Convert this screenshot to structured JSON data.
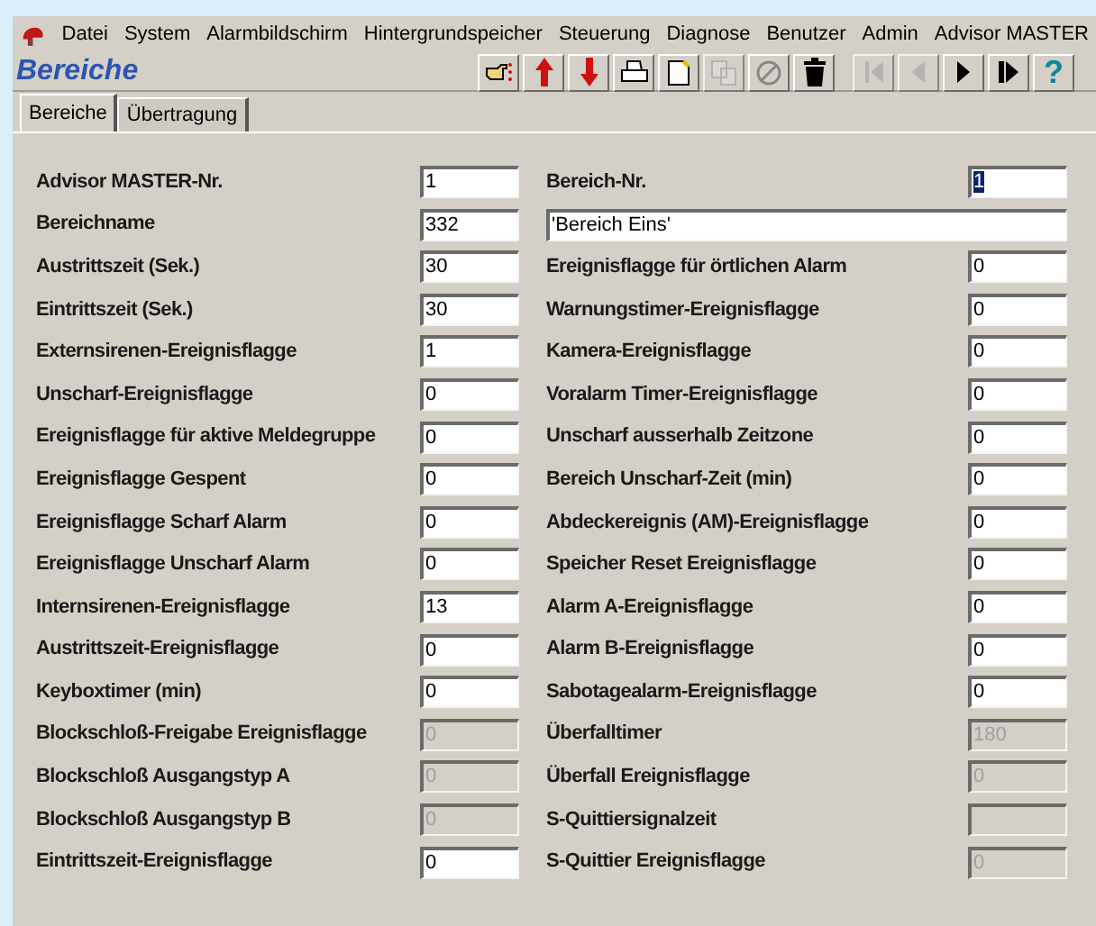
{
  "menu_bar": [
    "Datei",
    "System",
    "Alarmbildschirm",
    "Hintergrundspeicher",
    "Steuerung",
    "Diagnose",
    "Benutzer",
    "Admin",
    "Advisor MASTER"
  ],
  "window": {
    "title": "Bereiche"
  },
  "toolbar": [
    {
      "kind": "hand",
      "disabled": false
    },
    {
      "kind": "up",
      "disabled": false
    },
    {
      "kind": "down",
      "disabled": false
    },
    {
      "kind": "print",
      "disabled": false
    },
    {
      "kind": "new",
      "disabled": false
    },
    {
      "kind": "copy",
      "disabled": true
    },
    {
      "kind": "cancel",
      "disabled": false
    },
    {
      "kind": "trash",
      "disabled": false
    },
    {
      "kind": "first",
      "disabled": true
    },
    {
      "kind": "prev",
      "disabled": true
    },
    {
      "kind": "next",
      "disabled": false
    },
    {
      "kind": "last",
      "disabled": false
    },
    {
      "kind": "help",
      "label": "?",
      "disabled": false
    }
  ],
  "tabs": [
    {
      "label": "Bereiche",
      "selected": true
    },
    {
      "label": "Übertragung",
      "selected": false
    }
  ],
  "left_fields": [
    {
      "label": "Advisor MASTER-Nr.",
      "value": "1",
      "disabled": false
    },
    {
      "label": "Bereichname",
      "value": "332",
      "disabled": false
    },
    {
      "label": "Austrittszeit (Sek.)",
      "value": "30",
      "disabled": false
    },
    {
      "label": "Eintrittszeit (Sek.)",
      "value": "30",
      "disabled": false
    },
    {
      "label": "Externsirenen-Ereignisflagge",
      "value": "1",
      "disabled": false
    },
    {
      "label": "Unscharf-Ereignisflagge",
      "value": "0",
      "disabled": false
    },
    {
      "label": "Ereignisflagge für aktive Meldegruppe",
      "value": "0",
      "disabled": false
    },
    {
      "label": "Ereignisflagge Gespent",
      "value": "0",
      "disabled": false
    },
    {
      "label": "Ereignisflagge Scharf Alarm",
      "value": "0",
      "disabled": false
    },
    {
      "label": "Ereignisflagge Unscharf Alarm",
      "value": "0",
      "disabled": false
    },
    {
      "label": "Internsirenen-Ereignisflagge",
      "value": "13",
      "disabled": false
    },
    {
      "label": "Austrittszeit-Ereignisflagge",
      "value": "0",
      "disabled": false
    },
    {
      "label": "Keyboxtimer (min)",
      "value": "0",
      "disabled": false
    },
    {
      "label": "Blockschloß-Freigabe Ereignisflagge",
      "value": "0",
      "disabled": true
    },
    {
      "label": "Blockschloß Ausgangstyp A",
      "value": "0",
      "disabled": true
    },
    {
      "label": "Blockschloß Ausgangstyp B",
      "value": "0",
      "disabled": true
    },
    {
      "label": "Eintrittszeit-Ereignisflagge",
      "value": "0",
      "disabled": false
    }
  ],
  "right_fields": [
    {
      "kind": "labeled",
      "label": "Bereich-Nr.",
      "value": "1",
      "disabled": false,
      "focused": true
    },
    {
      "kind": "wide",
      "value": "'Bereich Eins'",
      "disabled": false,
      "focused": false
    },
    {
      "kind": "labeled",
      "label": "Ereignisflagge für örtlichen Alarm",
      "value": "0",
      "disabled": false,
      "focused": false
    },
    {
      "kind": "labeled",
      "label": "Warnungstimer-Ereignisflagge",
      "value": "0",
      "disabled": false,
      "focused": false
    },
    {
      "kind": "labeled",
      "label": "Kamera-Ereignisflagge",
      "value": "0",
      "disabled": false,
      "focused": false
    },
    {
      "kind": "labeled",
      "label": "Voralarm Timer-Ereignisflagge",
      "value": "0",
      "disabled": false,
      "focused": false
    },
    {
      "kind": "labeled",
      "label": "Unscharf ausserhalb Zeitzone",
      "value": "0",
      "disabled": false,
      "focused": false
    },
    {
      "kind": "labeled",
      "label": "Bereich Unscharf-Zeit (min)",
      "value": "0",
      "disabled": false,
      "focused": false
    },
    {
      "kind": "labeled",
      "label": "Abdeckereignis (AM)-Ereignisflagge",
      "value": "0",
      "disabled": false,
      "focused": false
    },
    {
      "kind": "labeled",
      "label": "Speicher Reset Ereignisflagge",
      "value": "0",
      "disabled": false,
      "focused": false
    },
    {
      "kind": "labeled",
      "label": "Alarm A-Ereignisflagge",
      "value": "0",
      "disabled": false,
      "focused": false
    },
    {
      "kind": "labeled",
      "label": "Alarm B-Ereignisflagge",
      "value": "0",
      "disabled": false,
      "focused": false
    },
    {
      "kind": "labeled",
      "label": "Sabotagealarm-Ereignisflagge",
      "value": "0",
      "disabled": false,
      "focused": false
    },
    {
      "kind": "labeled",
      "label": "Überfalltimer",
      "value": "180",
      "disabled": true,
      "focused": false
    },
    {
      "kind": "labeled",
      "label": "Überfall Ereignisflagge",
      "value": "0",
      "disabled": true,
      "focused": false
    },
    {
      "kind": "labeled",
      "label": "S-Quittiersignalzeit",
      "disabled": true,
      "focused": false
    },
    {
      "kind": "labeled",
      "label": "S-Quittier Ereignisflagge",
      "value": "0",
      "disabled": true,
      "focused": false
    }
  ]
}
